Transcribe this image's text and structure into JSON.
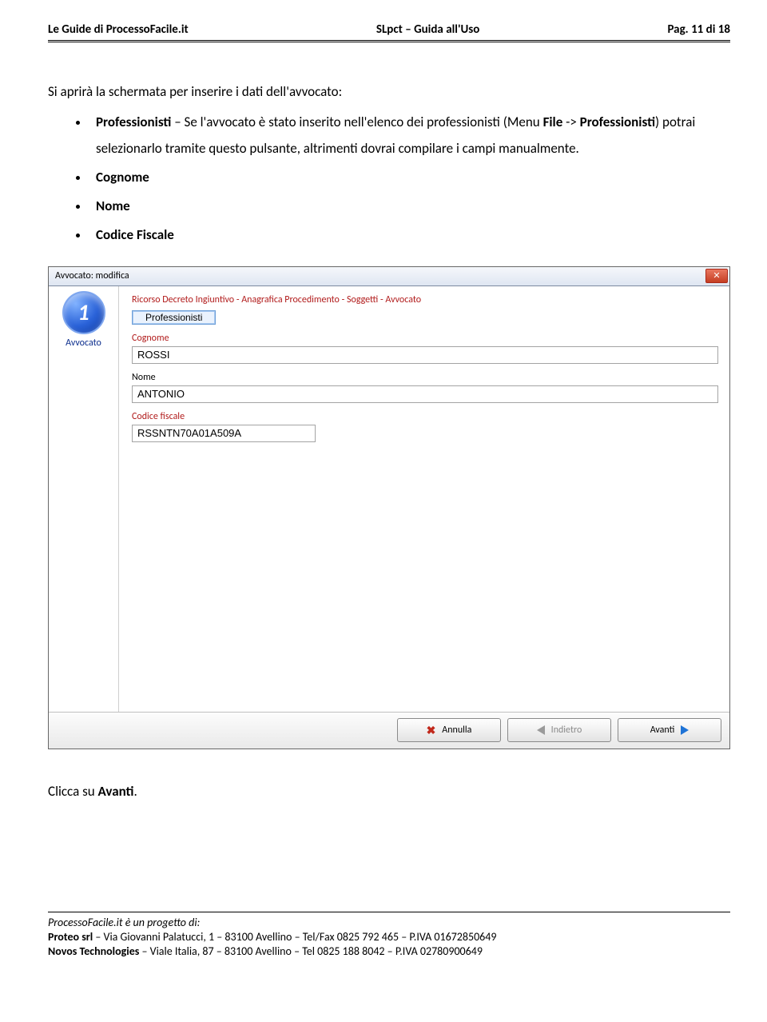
{
  "header": {
    "left": "Le Guide di ProcessoFacile.it",
    "center": "SLpct – Guida all'Uso",
    "right": "Pag. 11 di 18"
  },
  "intro": "Si aprirà la schermata per inserire i dati dell'avvocato:",
  "bullet1": {
    "label": "Professionisti",
    "cont1": " – Se l'avvocato è stato inserito nell'elenco dei professionisti (Menu ",
    "file": "File",
    "arrow": " -> ",
    "label2": "Professionisti",
    "cont2": ") potrai selezionarlo tramite questo pulsante, altrimenti dovrai compilare i campi manualmente."
  },
  "bullet2": "Cognome",
  "bullet3": "Nome",
  "bullet4": "Codice Fiscale",
  "dialog": {
    "title": "Avvocato: modifica",
    "step_num": "1",
    "step_label": "Avvocato",
    "breadcrumb": "Ricorso Decreto Ingiuntivo - Anagrafica Procedimento - Soggetti - Avvocato",
    "prof_button": "Professionisti",
    "fields": {
      "cognome_label": "Cognome",
      "cognome_value": "ROSSI",
      "nome_label": "Nome",
      "nome_value": "ANTONIO",
      "cf_label": "Codice fiscale",
      "cf_value": "RSSNTN70A01A509A"
    },
    "buttons": {
      "cancel": "Annulla",
      "back": "Indietro",
      "next": "Avanti"
    }
  },
  "after_text_pre": "Clicca su ",
  "after_text_bold": "Avanti",
  "after_text_post": ".",
  "footer": {
    "line1": "ProcessoFacile.it è un progetto di:",
    "line2a": "Proteo srl",
    "line2b": " – Via Giovanni Palatucci, 1 – 83100 Avellino – Tel/Fax 0825 792 465 – P.IVA 01672850649",
    "line3a": "Novos Technologies",
    "line3b": " – Viale Italia, 87 – 83100 Avellino – Tel 0825 188 8042 – P.IVA 02780900649"
  }
}
